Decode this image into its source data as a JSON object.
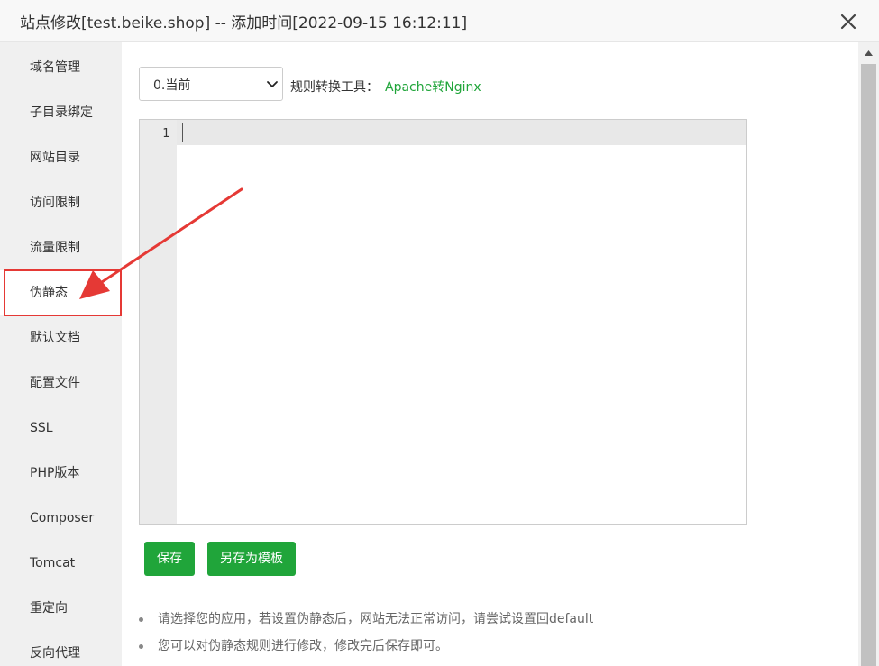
{
  "window": {
    "title": "站点修改[test.beike.shop] -- 添加时间[2022-09-15 16:12:11]",
    "close_icon": "close-icon"
  },
  "sidebar": {
    "items": [
      {
        "label": "域名管理"
      },
      {
        "label": "子目录绑定"
      },
      {
        "label": "网站目录"
      },
      {
        "label": "访问限制"
      },
      {
        "label": "流量限制"
      },
      {
        "label": "伪静态",
        "active": true
      },
      {
        "label": "默认文档"
      },
      {
        "label": "配置文件"
      },
      {
        "label": "SSL"
      },
      {
        "label": "PHP版本"
      },
      {
        "label": "Composer"
      },
      {
        "label": "Tomcat"
      },
      {
        "label": "重定向"
      },
      {
        "label": "反向代理"
      }
    ]
  },
  "main": {
    "template_select": {
      "value": "0.当前"
    },
    "converter": {
      "label": "规则转换工具：",
      "link": "Apache转Nginx"
    },
    "editor": {
      "line_numbers": [
        "1"
      ],
      "content": ""
    },
    "buttons": {
      "save": "保存",
      "save_as_template": "另存为模板"
    },
    "tips": [
      "请选择您的应用，若设置伪静态后，网站无法正常访问，请尝试设置回default",
      "您可以对伪静态规则进行修改，修改完后保存即可。"
    ]
  },
  "annotation": {
    "highlight_color": "#e53935",
    "target": "伪静态"
  },
  "colors": {
    "accent_green": "#20a53a",
    "sidebar_bg": "#f0f0f0",
    "titlebar_bg": "#f8f8f8"
  }
}
